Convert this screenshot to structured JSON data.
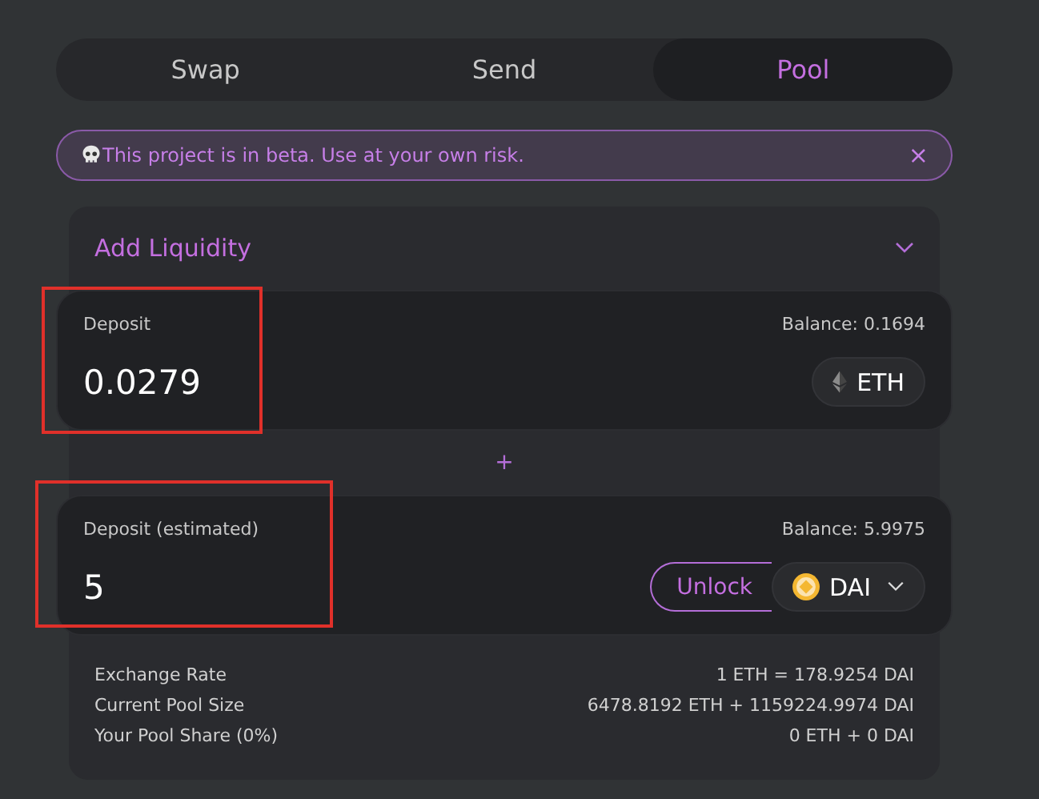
{
  "tabs": [
    {
      "label": "Swap",
      "selected": false
    },
    {
      "label": "Send",
      "selected": false
    },
    {
      "label": "Pool",
      "selected": true
    }
  ],
  "alert": {
    "text": "This project is in beta. Use at your own risk.",
    "close": "×"
  },
  "card": {
    "title": "Add Liquidity",
    "expanded": false,
    "inputs": [
      {
        "kind": "plain",
        "label": "Deposit",
        "balance": "Balance: 0.1694",
        "value": "0.0279",
        "token": "ETH",
        "highlighted": true
      },
      {
        "kind": "unlock",
        "label": "Deposit (estimated)",
        "balance": "Balance: 5.9975",
        "value": "5",
        "token": "DAI",
        "action": "Unlock",
        "highlighted": true
      }
    ],
    "separator": "+",
    "info": [
      {
        "label": "Exchange Rate",
        "value": "1 ETH = 178.9254 DAI"
      },
      {
        "label": "Current Pool Size",
        "value": "6478.8192 ETH + 1159224.9974 DAI"
      },
      {
        "label": "Your Pool Share (0%)",
        "value": "0 ETH + 0 DAI"
      }
    ]
  }
}
